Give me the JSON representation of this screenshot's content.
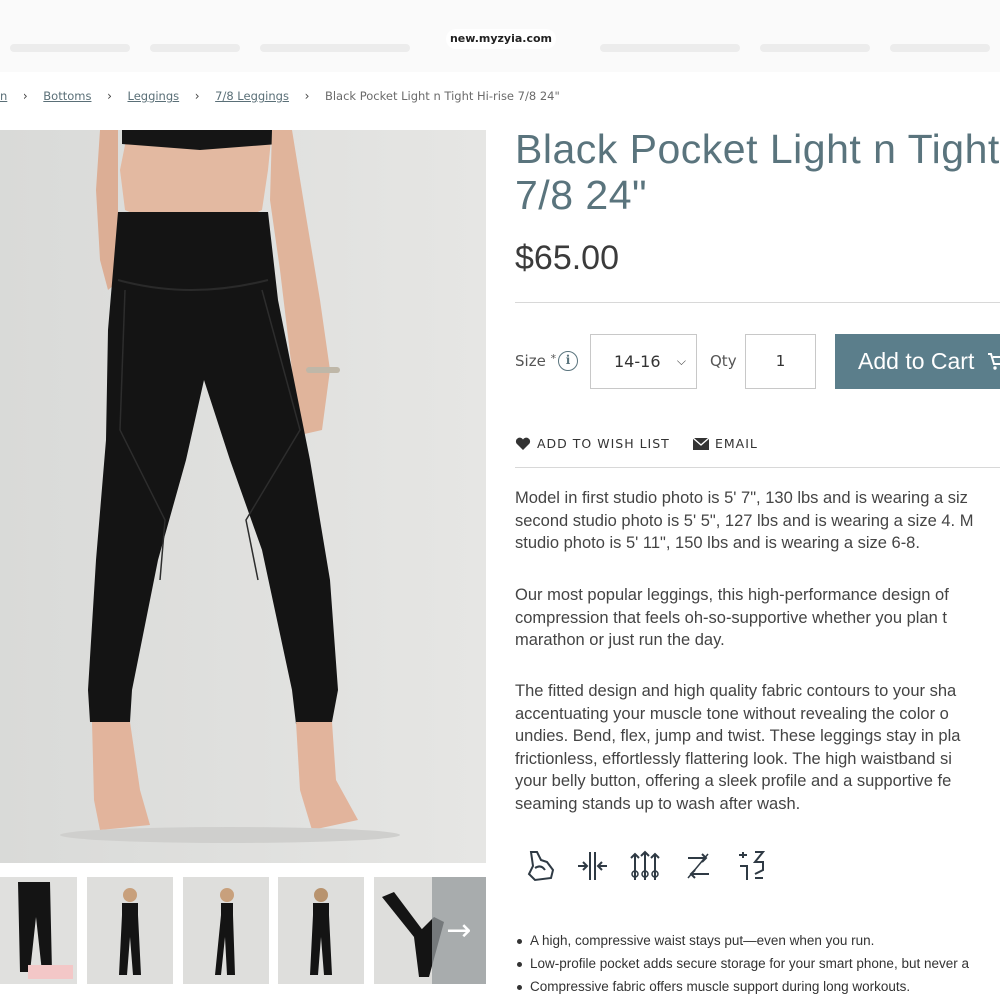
{
  "browser": {
    "url": "new.myzyia.com"
  },
  "breadcrumb": {
    "first": "n",
    "items": [
      "Bottoms",
      "Leggings",
      "7/8 Leggings"
    ],
    "current": "Black Pocket Light n Tight Hi-rise 7/8 24\""
  },
  "product": {
    "title_line1": "Black Pocket Light n Tight H",
    "title_line2": "7/8 24\"",
    "price": "$65.00",
    "size_label": "Size",
    "size_required": "*",
    "size_value": "14-16",
    "qty_label": "Qty",
    "qty_value": "1",
    "add_to_cart": "Add to Cart",
    "wishlist": "ADD TO WISH LIST",
    "email": "EMAIL"
  },
  "description": {
    "p1": [
      "Model in first studio photo is 5' 7\", 130 lbs and is wearing a siz",
      "second studio photo is 5' 5\", 127 lbs and is wearing a size 4. M",
      "studio photo is 5' 11\", 150 lbs and is wearing a size 6-8."
    ],
    "p2": [
      "Our most popular leggings, this high-performance design of",
      "compression that feels oh-so-supportive whether you plan t",
      "marathon or just run the day."
    ],
    "p3": [
      "The fitted design and high quality fabric contours to your sha",
      "accentuating your muscle tone without revealing the color o",
      "undies. Bend, flex, jump and twist. These leggings stay in pla",
      "frictionless, effortlessly flattering look. The high waistband si",
      "your belly button, offering a sleek profile and a supportive fe",
      "seaming stands up to wash after wash."
    ]
  },
  "feature_icons": [
    "muscle-support-icon",
    "compression-icon",
    "four-way-stretch-icon",
    "moisture-wicking-icon",
    "upf-protection-icon"
  ],
  "bullets": [
    "A high, compressive waist stays put—even when you run.",
    "Low-profile pocket adds secure storage for your smart phone, but never a",
    "Compressive fabric offers muscle support during long workouts."
  ],
  "colors": {
    "accent": "#5b7e8b",
    "title": "#5a747d",
    "text": "#444444"
  }
}
